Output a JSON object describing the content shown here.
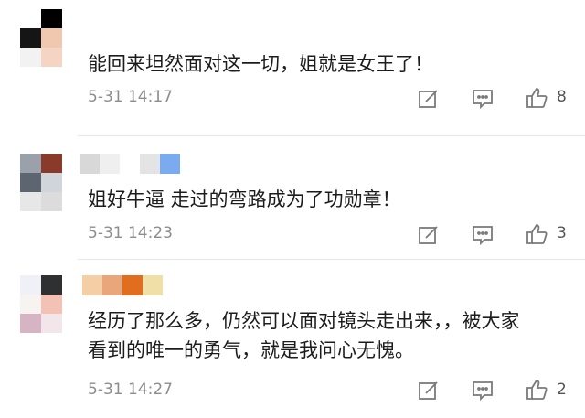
{
  "comments": [
    {
      "text": "能回来坦然面对这一切，姐就是女王了！",
      "time": "5-31 14:17",
      "likes": "8",
      "avatar_colors": [
        "#000000",
        "#151515",
        "#1e1e1e",
        "#f0c8b0",
        "#f2f2f2",
        "#f6d4c4"
      ],
      "name_colors": []
    },
    {
      "text": "姐好牛逼 走过的弯路成为了功勋章！",
      "time": "5-31 14:23",
      "likes": "3",
      "avatar_colors": [
        "#9aa1aa",
        "#8a3a2a",
        "#5d6570",
        "#cfd5db",
        "#e7e7e7",
        "#dcdcdc"
      ],
      "name_colors": [
        "#d8d8d8",
        "#efefef",
        "#e4e4e4",
        "#7aaaf0"
      ]
    },
    {
      "text": "经历了那么多，仍然可以面对镜头走出来，，被大家\n看到的唯一的勇气，就是我问心无愧。",
      "time": "5-31 14:27",
      "likes": "2",
      "avatar_colors": [
        "#eff1f6",
        "#2f3032",
        "#f6f3f0",
        "#f3c2b4",
        "#d6b4c3",
        "#f3e6ea"
      ],
      "name_colors": [
        "#f4cfa6",
        "#e9a67a",
        "#e06e1e",
        "#f1dfa8"
      ]
    }
  ],
  "icons": {
    "edit": "edit-icon",
    "comment": "comment-icon",
    "like": "thumbs-up-icon"
  }
}
